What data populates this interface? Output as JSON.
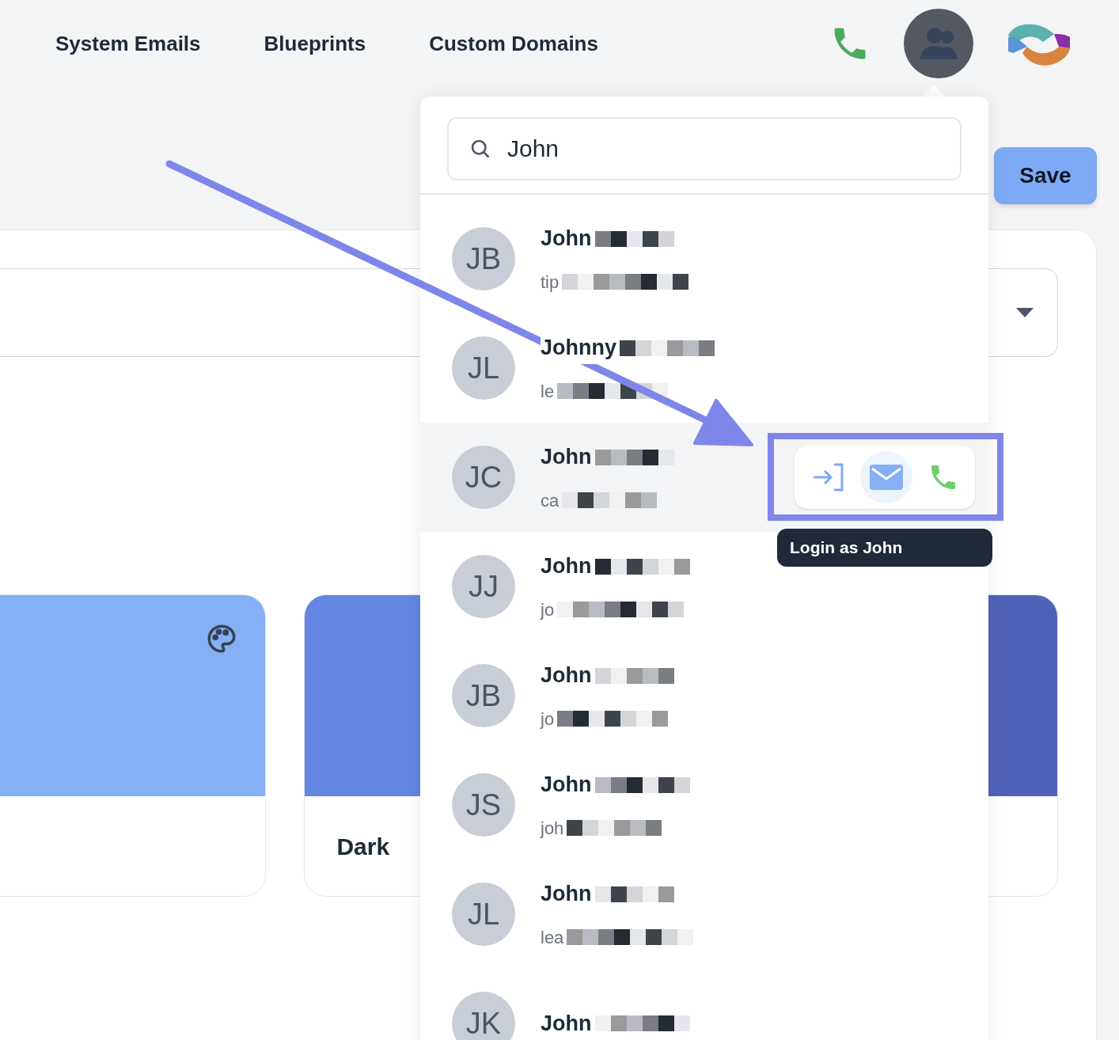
{
  "nav": {
    "links": [
      "System Emails",
      "Blueprints",
      "Custom Domains"
    ]
  },
  "save_button": "Save",
  "theme_cards": [
    {
      "color": "#86b0f5",
      "palette_icon": true
    },
    {
      "color": "#6486e0",
      "label": "Dark"
    },
    {
      "color": "#5062b8"
    }
  ],
  "people_search": {
    "value": "John"
  },
  "contacts": [
    {
      "initials": "JB",
      "name": "John",
      "email": "tip",
      "selected": false
    },
    {
      "initials": "JL",
      "name": "Johnny",
      "email": "le",
      "selected": false
    },
    {
      "initials": "JC",
      "name": "John",
      "email": "ca",
      "selected": true
    },
    {
      "initials": "JJ",
      "name": "John",
      "email": "jo",
      "selected": false
    },
    {
      "initials": "JB",
      "name": "John",
      "email": "jo",
      "selected": false
    },
    {
      "initials": "JS",
      "name": "John",
      "email": "joh",
      "selected": false
    },
    {
      "initials": "JL",
      "name": "John",
      "email": "lea",
      "selected": false
    },
    {
      "initials": "JK",
      "name": "John",
      "selected": false
    }
  ],
  "tooltip": "Login as John"
}
